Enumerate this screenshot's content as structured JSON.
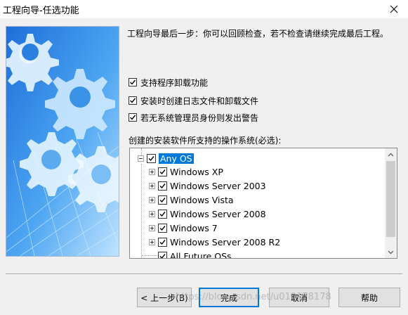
{
  "window": {
    "title": "工程向导-任选功能",
    "close_icon": "close-icon"
  },
  "intro_text": "工程向导最后一步：你可以回顾检查，若不检查请继续完成最后工程。",
  "options": [
    {
      "label": "支持程序卸载功能",
      "checked": true
    },
    {
      "label": "安装时创建日志文件和卸载文件",
      "checked": true
    },
    {
      "label": "若无系统管理员身份则发出警告",
      "checked": true
    }
  ],
  "os_section_label": "创建的安装软件所支持的操作系统(必选):",
  "os_tree": {
    "root": {
      "label": "Any OS",
      "checked": true,
      "selected": true
    },
    "children": [
      {
        "label": "Windows XP",
        "checked": true,
        "expandable": true
      },
      {
        "label": "Windows Server 2003",
        "checked": true,
        "expandable": true
      },
      {
        "label": "Windows Vista",
        "checked": true,
        "expandable": true
      },
      {
        "label": "Windows Server 2008",
        "checked": true,
        "expandable": true
      },
      {
        "label": "Windows 7",
        "checked": true,
        "expandable": true
      },
      {
        "label": "Windows Server 2008 R2",
        "checked": true,
        "expandable": true
      },
      {
        "label": "All Future OSs",
        "checked": true,
        "expandable": false
      }
    ]
  },
  "buttons": {
    "back": "< 上一步(B)",
    "finish": "完成",
    "cancel": "取消",
    "help": "帮助"
  },
  "watermark": "https://blog.csdn.net/u010178178",
  "colors": {
    "selection": "#0078d7",
    "default_button_border": "#0078d7",
    "image_sky": "#2a7fe0"
  }
}
